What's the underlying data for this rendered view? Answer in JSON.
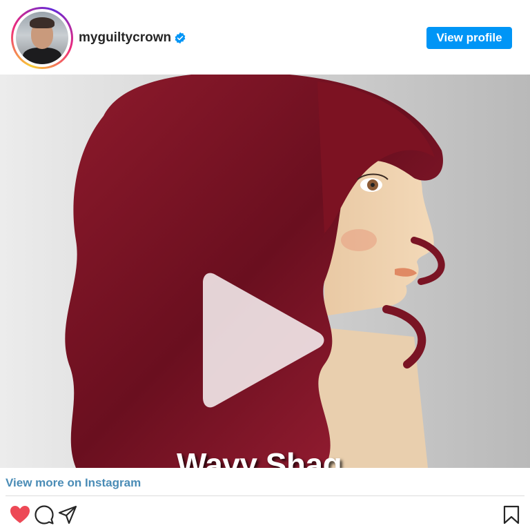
{
  "header": {
    "username": "myguiltycrown",
    "verified_icon": "verified-badge-icon",
    "view_profile_label": "View profile"
  },
  "media": {
    "caption": "Wavy Shag",
    "play_icon": "play-icon"
  },
  "footer": {
    "more_link": "View more on Instagram",
    "actions": [
      "heart-icon",
      "comment-icon",
      "share-icon",
      "bookmark-icon"
    ]
  },
  "colors": {
    "button_blue": "#0095f6",
    "link_blue": "#4a8cb6",
    "heart_red": "#ed4956",
    "hair": "#7a1424"
  }
}
